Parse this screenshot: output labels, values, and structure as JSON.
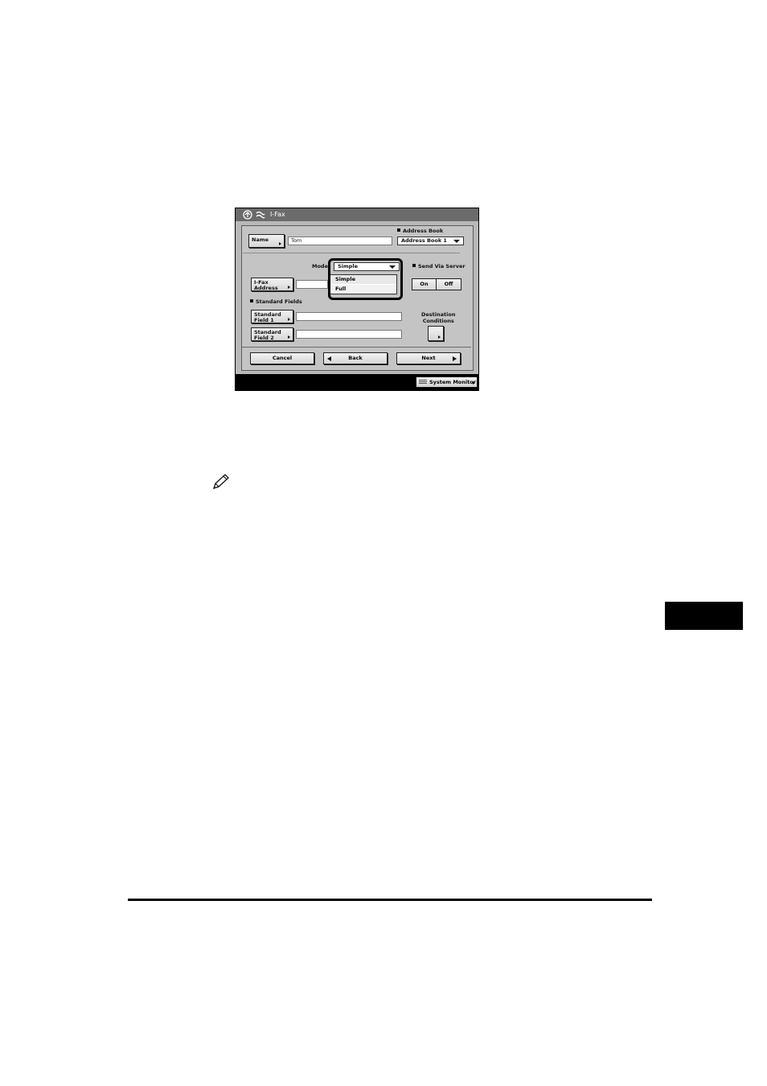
{
  "titlebar": {
    "title": "I-Fax",
    "icons": [
      "network-icon",
      "fax-icon"
    ]
  },
  "name_button": {
    "label": "Name"
  },
  "name_field": {
    "value": "Tom"
  },
  "address_book": {
    "label": "Address Book",
    "selected": "Address Book 1"
  },
  "mode": {
    "label": "Mode:",
    "selected": "Simple",
    "options": [
      "Simple",
      "Full"
    ]
  },
  "ifax_address_button": {
    "label": "I-Fax\nAddress"
  },
  "ifax_address_field": {
    "value": ""
  },
  "send_via_server": {
    "label": "Send Via Server",
    "on_label": "On",
    "off_label": "Off",
    "state": "Off"
  },
  "standard_fields": {
    "heading": "Standard Fields",
    "field1_label": "Standard\nField 1",
    "field2_label": "Standard\nField 2"
  },
  "destination_conditions": {
    "label": "Destination\nConditions"
  },
  "footer_buttons": {
    "cancel": "Cancel",
    "back": "Back",
    "next": "Next"
  },
  "system_monitor": {
    "label": "System Monitor"
  },
  "colors": {
    "panel_bg": "#b9b9b9",
    "titlebar_bg": "#6b6b6b",
    "screen_frame": "#000000"
  }
}
